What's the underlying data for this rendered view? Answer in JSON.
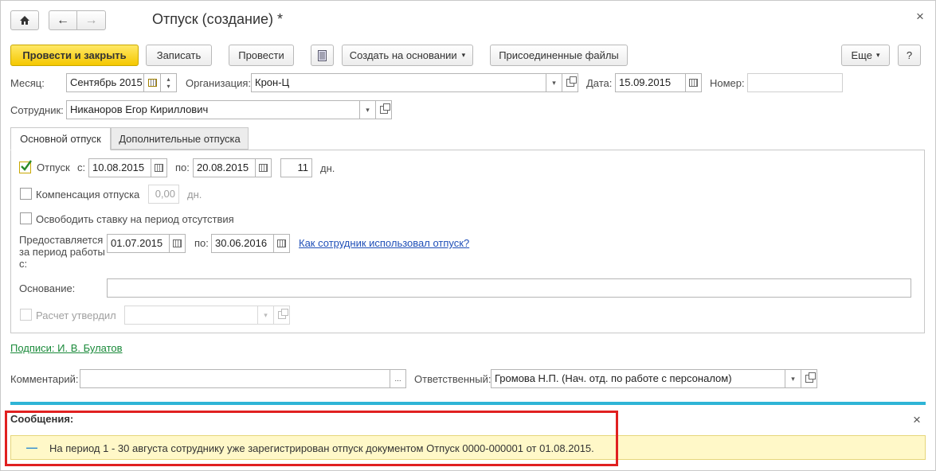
{
  "window": {
    "title": "Отпуск (создание) *",
    "close_icon": "×"
  },
  "nav": {
    "home_icon": "home",
    "back_icon": "←",
    "forward_icon": "→"
  },
  "toolbar": {
    "post_close": "Провести и закрыть",
    "save": "Записать",
    "post": "Провести",
    "create_based": "Создать на основании",
    "attached_files": "Присоединенные файлы",
    "more": "Еще",
    "help": "?"
  },
  "header": {
    "month_label": "Месяц:",
    "month_value": "Сентябрь 2015",
    "org_label": "Организация:",
    "org_value": "Крон-Ц",
    "date_label": "Дата:",
    "date_value": "15.09.2015",
    "number_label": "Номер:",
    "number_value": "",
    "employee_label": "Сотрудник:",
    "employee_value": "Никаноров Егор Кириллович"
  },
  "tabs": [
    {
      "label": "Основной отпуск"
    },
    {
      "label": "Дополнительные отпуска"
    }
  ],
  "main": {
    "vacation_label": "Отпуск",
    "from_label": "с:",
    "from_value": "10.08.2015",
    "to_label": "по:",
    "to_value": "20.08.2015",
    "days_value": "11",
    "days_unit": "дн.",
    "compensation_label": "Компенсация отпуска",
    "compensation_value": "0,00",
    "compensation_unit": "дн.",
    "release_rate_label": "Освободить ставку на период отсутствия",
    "period_label_1": "Предоставляется",
    "period_label_2": "за период работы",
    "period_label_3": "с:",
    "period_from": "01.07.2015",
    "period_to_label": "по:",
    "period_to": "30.06.2016",
    "usage_link": "Как сотрудник использовал отпуск?",
    "basis_label": "Основание:",
    "basis_value": "",
    "approved_label": "Расчет утвердил",
    "approved_value": ""
  },
  "signatures_link": "Подписи: И. В. Булатов",
  "footer": {
    "comment_label": "Комментарий:",
    "comment_value": "",
    "comment_btn": "...",
    "responsible_label": "Ответственный:",
    "responsible_value": "Громова Н.П. (Нач. отд. по работе с персоналом)"
  },
  "messages": {
    "title": "Сообщения:",
    "close_icon": "×",
    "bullet": "—",
    "text": "На период 1 - 30 августа сотруднику уже зарегистрирован отпуск документом Отпуск 0000-000001 от 01.08.2015."
  },
  "colors": {
    "accent_bar": "#2eb4d6",
    "highlight_border": "#e02020",
    "message_bg": "#fff8c8",
    "primary": "#f5c800",
    "link_blue": "#1f4fb8",
    "link_green": "#1a8a3a"
  }
}
